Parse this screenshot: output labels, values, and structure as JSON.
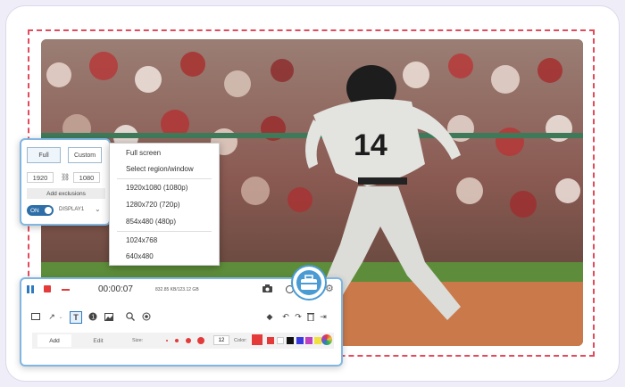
{
  "capture_panel": {
    "mode_full": "Full",
    "mode_custom": "Custom",
    "width": "1920",
    "height": "1080",
    "add_exclusions": "Add exclusions",
    "toggle": "ON",
    "display": "DISPLAY1"
  },
  "menu": {
    "items": [
      "Full screen",
      "Select region/window",
      "1920x1080 (1080p)",
      "1280x720 (720p)",
      "854x480 (480p)",
      "1024x768",
      "640x480"
    ]
  },
  "toolbar": {
    "timer": "00:00:07",
    "stats": "832.85 KB/123.12 GB",
    "tab_add": "Add",
    "tab_edit": "Edit",
    "size_label": "Size:",
    "size_value": "12",
    "color_label": "Color:"
  },
  "photo": {
    "jersey_number": "14"
  },
  "colors": {
    "accent": "#2e7ac0",
    "record_red": "#e43a3a",
    "dashed_border": "#e34b5c",
    "palette": [
      "#e43a3a",
      "#e43a3a",
      "#ffffff",
      "#111111",
      "#3a3ae0",
      "#c040c0",
      "#f0e040",
      "#3a8ad0"
    ]
  },
  "icons": [
    "pause-icon",
    "stop-icon",
    "minimize-icon",
    "camera-icon",
    "clock-icon",
    "settings-icon",
    "toolbox-icon",
    "rectangle-icon",
    "arrow-icon",
    "text-icon",
    "number-icon",
    "image-icon",
    "zoom-icon",
    "spotlight-icon",
    "eraser-icon",
    "undo-icon",
    "redo-icon",
    "delete-icon",
    "export-icon"
  ]
}
